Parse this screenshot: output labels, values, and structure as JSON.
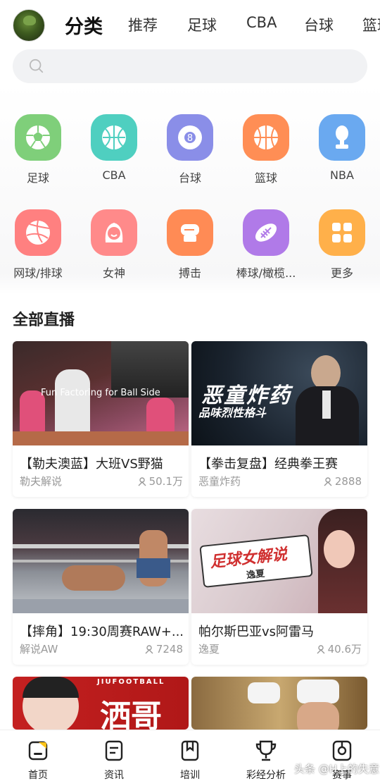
{
  "tabs": [
    "分类",
    "推荐",
    "足球",
    "CBA",
    "台球",
    "篮球"
  ],
  "search": {
    "placeholder": ""
  },
  "categories": [
    {
      "label": "足球",
      "icon": "soccer-ball-icon",
      "color": "#7fcf7a"
    },
    {
      "label": "CBA",
      "icon": "basketball-icon",
      "color": "#4fcfc0"
    },
    {
      "label": "台球",
      "icon": "billiard-ball-icon",
      "color": "#8a8ee8"
    },
    {
      "label": "篮球",
      "icon": "basketball-icon",
      "color": "#ff8e55"
    },
    {
      "label": "NBA",
      "icon": "trophy-icon",
      "color": "#6aa9f0"
    },
    {
      "label": "网球/排球",
      "icon": "volleyball-icon",
      "color": "#ff8080"
    },
    {
      "label": "女神",
      "icon": "girl-icon",
      "color": "#ff8a8a"
    },
    {
      "label": "搏击",
      "icon": "boxing-glove-icon",
      "color": "#ff8b55"
    },
    {
      "label": "棒球/橄榄...",
      "icon": "rugby-ball-icon",
      "color": "#b07ae8"
    },
    {
      "label": "更多",
      "icon": "grid-icon",
      "color": "#ffb04a"
    }
  ],
  "section": {
    "title": "全部直播"
  },
  "streams": [
    {
      "title": "【勒夫澳蓝】大班VS野猫",
      "author": "勒夫解说",
      "views": "50.1万",
      "overlay": "Fun Factoring for Ball Side"
    },
    {
      "title": "【拳击复盘】经典拳王赛",
      "author": "恶童炸药",
      "views": "2888",
      "overlay": "恶童炸药",
      "overlay2": "品味烈性格斗"
    },
    {
      "title": "【摔角】19:30周赛RAW+...",
      "author": "解说AW",
      "views": "7248"
    },
    {
      "title": "帕尔斯巴亚vs阿雷马",
      "author": "逸夏",
      "views": "40.6万",
      "overlay": "足球女解说",
      "overlay2": "逸夏"
    },
    {
      "title": "",
      "author": "",
      "views": "",
      "overlay": "洒哥",
      "overlay2": "JIUFOOTBALL"
    },
    {
      "title": "",
      "author": "",
      "views": ""
    }
  ],
  "bottomnav": [
    {
      "label": "首页",
      "icon": "home-icon"
    },
    {
      "label": "资讯",
      "icon": "news-icon"
    },
    {
      "label": "培训",
      "icon": "bookmark-icon"
    },
    {
      "label": "彩经分析",
      "icon": "trophy-cup-icon"
    },
    {
      "label": "赛事",
      "icon": "match-icon"
    }
  ],
  "watermark": "头条 @H上的失意"
}
